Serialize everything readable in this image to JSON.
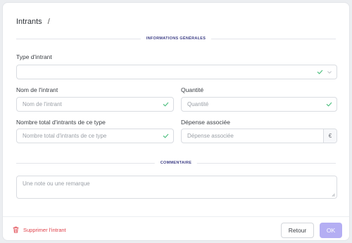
{
  "header": {
    "title": "Intrants",
    "separator": "/"
  },
  "sections": {
    "general": "INFORMATIONS GÉNÉRALES",
    "comment": "COMMENTAIRE"
  },
  "fields": {
    "type": {
      "label": "Type d'intrant",
      "value": ""
    },
    "name": {
      "label": "Nom de l'intrant",
      "placeholder": "Nom de l'intrant"
    },
    "quantity": {
      "label": "Quantité",
      "placeholder": "Quantité"
    },
    "total": {
      "label": "Nombre total d'intrants de ce type",
      "placeholder": "Nombre total d'intrants de ce type"
    },
    "expense": {
      "label": "Dépense associée",
      "placeholder": "Dépense associée",
      "currency": "€"
    },
    "comment": {
      "placeholder": "Une note ou une remarque"
    }
  },
  "footer": {
    "delete_label": "Supprimer l'intrant",
    "back_label": "Retour",
    "ok_label": "OK"
  },
  "colors": {
    "accent": "#3e3f86",
    "valid": "#4cbf7e",
    "danger": "#e0424b",
    "ok_button": "#b4aef3"
  },
  "icons": {
    "valid": "check-icon",
    "dropdown": "chevron-down-icon",
    "delete": "trash-icon"
  }
}
